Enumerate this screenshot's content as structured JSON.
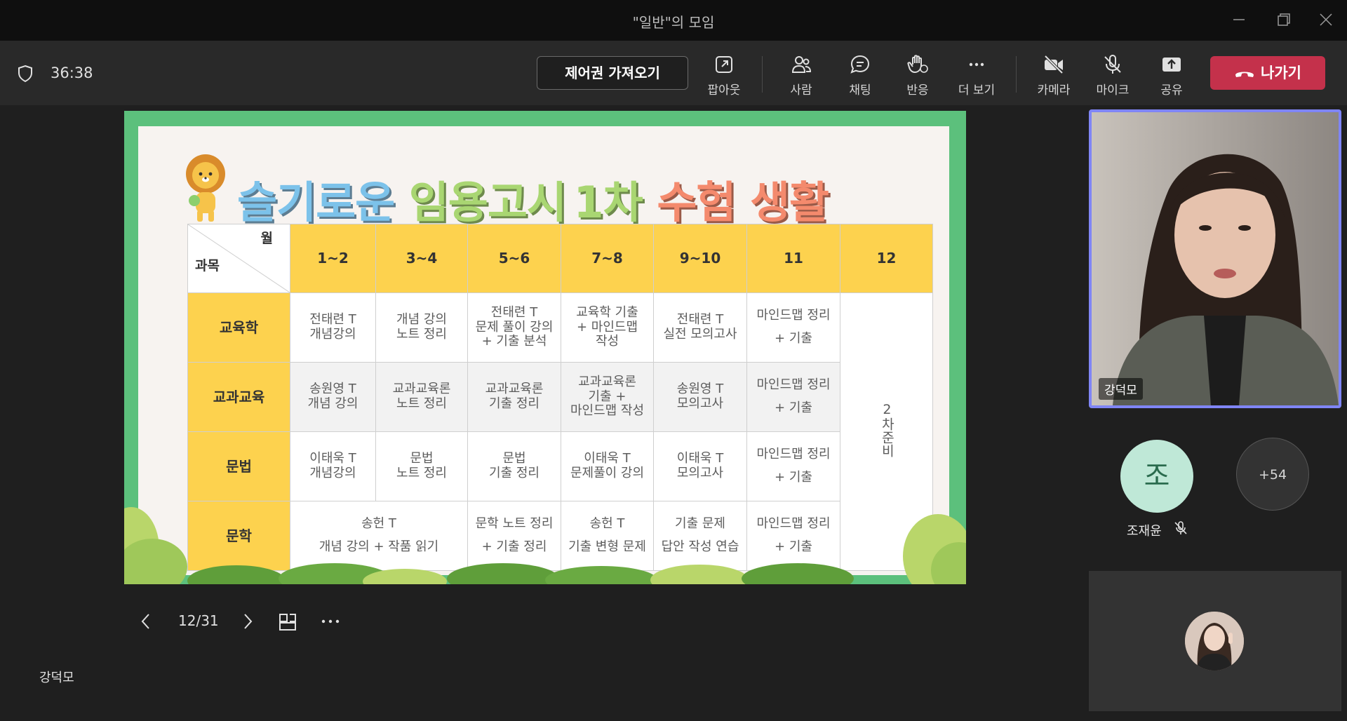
{
  "window": {
    "title": "\"일반\"의 모임"
  },
  "toolbar": {
    "timer": "36:38",
    "control_label": "제어권 가져오기",
    "popout": "팝아웃",
    "people": "사람",
    "chat": "채팅",
    "react": "반응",
    "more": "더 보기",
    "camera": "카메라",
    "mic": "마이크",
    "share": "공유",
    "leave": "나가기"
  },
  "slide": {
    "title_parts": [
      "슬기로운",
      "임용고시",
      "1차",
      "수험",
      "생활"
    ],
    "title_colors": [
      "#7cc2ea",
      "#a9d672",
      "#a9d672",
      "#f48a6d",
      "#f48a6d"
    ],
    "corner_month": "월",
    "corner_subject": "과목",
    "months": [
      "1~2",
      "3~4",
      "5~6",
      "7~8",
      "9~10",
      "11",
      "12"
    ],
    "side_note": "2차준비",
    "rows": [
      {
        "subject": "교육학",
        "cells": [
          [
            "전태련 T",
            "개념강의"
          ],
          [
            "개념 강의",
            "노트 정리"
          ],
          [
            "전태련 T",
            "문제 풀이 강의",
            "+ 기출 분석"
          ],
          [
            "교육학 기출",
            "+ 마인드맵",
            "작성"
          ],
          [
            "전태련 T",
            "실전 모의고사"
          ],
          [
            "마인드맵 정리",
            "+ 기출"
          ]
        ]
      },
      {
        "subject": "교과교육",
        "cells": [
          [
            "송원영 T",
            "개념 강의"
          ],
          [
            "교과교육론",
            "노트 정리"
          ],
          [
            "교과교육론",
            "기출 정리"
          ],
          [
            "교과교육론",
            "기출 +",
            "마인드맵 작성"
          ],
          [
            "송원영 T",
            "모의고사"
          ],
          [
            "마인드맵 정리",
            "+ 기출"
          ]
        ]
      },
      {
        "subject": "문법",
        "cells": [
          [
            "이태욱 T",
            "개념강의"
          ],
          [
            "문법",
            "노트 정리"
          ],
          [
            "문법",
            "기출 정리"
          ],
          [
            "이태욱 T",
            "문제풀이 강의"
          ],
          [
            "이태욱 T",
            "모의고사"
          ],
          [
            "마인드맵 정리",
            "+ 기출"
          ]
        ]
      },
      {
        "subject": "문학",
        "merged": [
          "송헌 T",
          "개념 강의 + 작품 읽기"
        ],
        "cells": [
          [
            "문학 노트 정리",
            "+ 기출 정리"
          ],
          [
            "송헌 T",
            "기출 변형 문제"
          ],
          [
            "기출 문제",
            "답안 작성 연습"
          ],
          [
            "마인드맵 정리",
            "+ 기출"
          ]
        ]
      }
    ]
  },
  "slide_nav": {
    "page": "12/31"
  },
  "presenter_name": "강덕모",
  "participants": {
    "video_name": "강덕모",
    "avatar_initial": "조",
    "avatar_name": "조재윤",
    "more_count": "+54"
  }
}
